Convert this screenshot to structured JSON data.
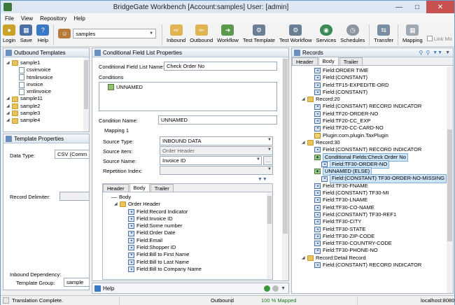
{
  "window": {
    "title": "BridgeGate Workbench [Account:samples] User: [admin]"
  },
  "menu": [
    "File",
    "View",
    "Repository",
    "Help"
  ],
  "toolbar": {
    "login": "Login",
    "save": "Save",
    "help": "Help",
    "account": "samples",
    "inbound": "Inbound",
    "outbound": "Outbound",
    "workflow": "Workflow",
    "test_template": "Test Template",
    "test_workflow": "Test Workflow",
    "services": "Services",
    "schedules": "Schedules",
    "transfer": "Transfer",
    "mapping": "Mapping",
    "link_mode": "Link Mo"
  },
  "outbound_templates": {
    "title": "Outbound Templates",
    "items": [
      {
        "label": "sample1",
        "level": 0,
        "kind": "folder",
        "expanded": true
      },
      {
        "label": "csvinvoice",
        "level": 1,
        "kind": "doc"
      },
      {
        "label": "htmlinvoice",
        "level": 1,
        "kind": "doc"
      },
      {
        "label": "invoice",
        "level": 1,
        "kind": "doc"
      },
      {
        "label": "xmlinvoice",
        "level": 1,
        "kind": "doc"
      },
      {
        "label": "sample11",
        "level": 0,
        "kind": "folder"
      },
      {
        "label": "sample2",
        "level": 0,
        "kind": "folder"
      },
      {
        "label": "sample3",
        "level": 0,
        "kind": "folder"
      },
      {
        "label": "sample4",
        "level": 0,
        "kind": "folder"
      }
    ]
  },
  "template_properties": {
    "title": "Template Properties",
    "data_type_label": "Data Type:",
    "data_type_value": "CSV (Comm",
    "record_delimiter_label": "Record Delimiter:",
    "inbound_dependency_label": "Inbound Dependency:",
    "template_group_label": "Template Group:",
    "template_group_value": "sample"
  },
  "cfl": {
    "title": "Conditional Field List Properties",
    "name_label": "Conditional Field List Name:",
    "name_value": "Check Order No",
    "conditions_label": "Conditions",
    "condition_item": "UNNAMED",
    "condition_name_label": "Condition Name:",
    "condition_name_value": "UNNAMED",
    "mapping_label": "Mapping 1",
    "source_type_label": "Source Type:",
    "source_type_value": "INBOUND DATA",
    "source_item_label": "Source Item:",
    "source_item_value": "Order Header",
    "source_name_label": "Source Name:",
    "source_name_value": "Invoice ID",
    "repetition_label": "Repetition Index:",
    "tabs": [
      "Header",
      "Body",
      "Trailer"
    ],
    "tree": [
      {
        "label": "Body",
        "level": 0,
        "kind": "line"
      },
      {
        "label": "Order Header",
        "level": 1,
        "kind": "folder"
      },
      {
        "label": "Field:Record Indicator",
        "level": 2,
        "kind": "field"
      },
      {
        "label": "Field:Invoice ID",
        "level": 2,
        "kind": "field"
      },
      {
        "label": "Field:Some number",
        "level": 2,
        "kind": "field"
      },
      {
        "label": "Field:Order Date",
        "level": 2,
        "kind": "field"
      },
      {
        "label": "Field:Email",
        "level": 2,
        "kind": "field"
      },
      {
        "label": "Field:Shopper ID",
        "level": 2,
        "kind": "field"
      },
      {
        "label": "Field:Bill to First Name",
        "level": 2,
        "kind": "field"
      },
      {
        "label": "Field:Bill to Last Name",
        "level": 2,
        "kind": "field"
      },
      {
        "label": "Field:Bill to Company Name",
        "level": 2,
        "kind": "field"
      }
    ]
  },
  "help_panel": {
    "title": "Help"
  },
  "records": {
    "title": "Records",
    "tabs": [
      "Header",
      "Body",
      "Trailer"
    ],
    "tree": [
      {
        "label": "Field:ORDER TIME",
        "level": 2,
        "kind": "field"
      },
      {
        "label": "Field:(CONSTANT)",
        "level": 2,
        "kind": "field"
      },
      {
        "label": "Field:TF15-EXPEDITE-ORD",
        "level": 2,
        "kind": "field"
      },
      {
        "label": "Field:(CONSTANT)",
        "level": 2,
        "kind": "field"
      },
      {
        "label": "Record:20",
        "level": 1,
        "kind": "folder"
      },
      {
        "label": "Field:(CONSTANT) RECORD INDICATOR",
        "level": 2,
        "kind": "field"
      },
      {
        "label": "Field:TF20-ORDER-NO",
        "level": 2,
        "kind": "field"
      },
      {
        "label": "Field:TF20-CC_EXP",
        "level": 2,
        "kind": "field"
      },
      {
        "label": "Field:TF20-CC-CARD-NO",
        "level": 2,
        "kind": "field"
      },
      {
        "label": "Plugin:com.plugin.TaxPlugin",
        "level": 2,
        "kind": "plugin"
      },
      {
        "label": "Record:30",
        "level": 1,
        "kind": "folder"
      },
      {
        "label": "Field:(CONSTANT) RECORD INDICATOR",
        "level": 2,
        "kind": "field"
      },
      {
        "label": "Conditional Fields:Check Order No",
        "level": 2,
        "kind": "cond",
        "selected": true
      },
      {
        "label": "Field:TF30-ORDER-NO",
        "level": 3,
        "kind": "field",
        "selected": true
      },
      {
        "label": "UNNAMED (ELSE)",
        "level": 2,
        "kind": "cond",
        "selected": true
      },
      {
        "label": "Field:(CONSTANT) TF30-ORDER-NO-MISSING",
        "level": 3,
        "kind": "field",
        "selected": true
      },
      {
        "label": "Field:TF30-FNAME",
        "level": 2,
        "kind": "field"
      },
      {
        "label": "Field:(CONSTANT) TF30-MI",
        "level": 2,
        "kind": "field"
      },
      {
        "label": "Field:TF30-LNAME",
        "level": 2,
        "kind": "field"
      },
      {
        "label": "Field:TF30-CO-NAME",
        "level": 2,
        "kind": "field"
      },
      {
        "label": "Field:(CONSTANT) TF30-REF1",
        "level": 2,
        "kind": "field"
      },
      {
        "label": "Field:TF30-CITY",
        "level": 2,
        "kind": "field"
      },
      {
        "label": "Field:TF30-STATE",
        "level": 2,
        "kind": "field"
      },
      {
        "label": "Field:TF30-ZIP-CODE",
        "level": 2,
        "kind": "field"
      },
      {
        "label": "Field:TF30-COUNTRY-CODE",
        "level": 2,
        "kind": "field"
      },
      {
        "label": "Field:TF30-PHONE-NO",
        "level": 2,
        "kind": "field"
      },
      {
        "label": "Record:Detail Record",
        "level": 1,
        "kind": "folder"
      },
      {
        "label": "Field:(CONSTANT) RECORD INDICATOR",
        "level": 2,
        "kind": "field"
      }
    ]
  },
  "status": {
    "message": "Translation Complete.",
    "mode": "Outbound",
    "mapped": "100 % Mapped",
    "host": "localhost:8080"
  }
}
